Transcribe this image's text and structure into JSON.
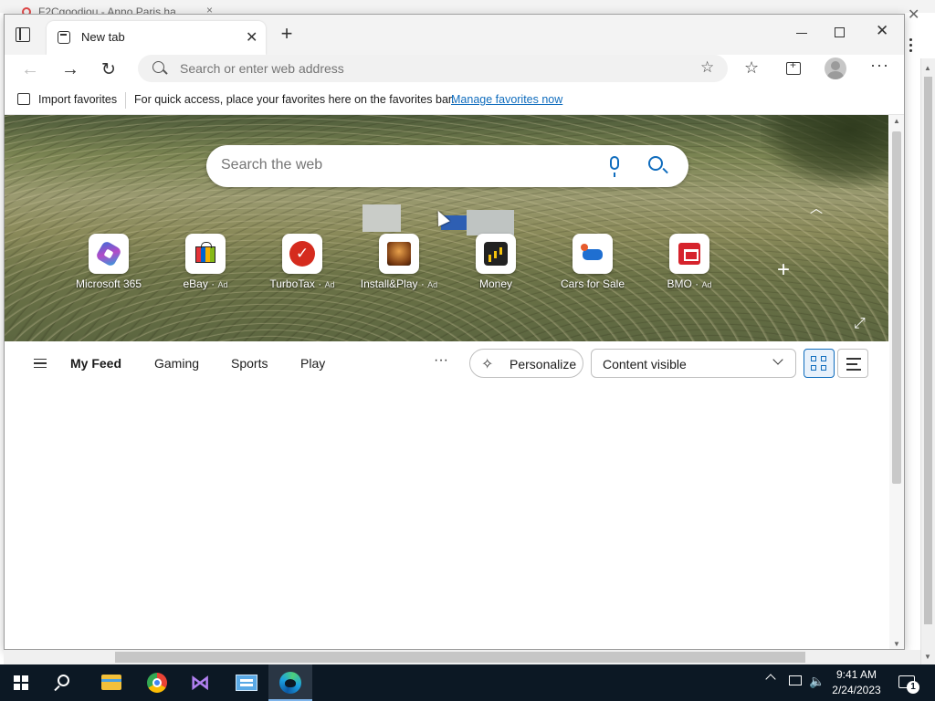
{
  "background_window": {
    "tab_title": "F2Cgoodiou - Anno Paris ha"
  },
  "browser": {
    "tab_title": "New tab",
    "address_placeholder": "Search or enter web address",
    "favorites_bar": {
      "import_label": "Import favorites",
      "message": "For quick access, place your favorites here on the favorites bar.",
      "manage_link": "Manage favorites now"
    }
  },
  "new_tab": {
    "search_placeholder": "Search the web",
    "tiles": [
      {
        "label": "Microsoft 365",
        "ad": ""
      },
      {
        "label": "eBay",
        "ad": "Ad"
      },
      {
        "label": "TurboTax",
        "ad": "Ad"
      },
      {
        "label": "Install&Play",
        "ad": "Ad"
      },
      {
        "label": "Money",
        "ad": ""
      },
      {
        "label": "Cars for Sale",
        "ad": ""
      },
      {
        "label": "BMO",
        "ad": "Ad"
      }
    ],
    "feed_tabs": [
      "My Feed",
      "Gaming",
      "Sports",
      "Play"
    ],
    "more_label": "···",
    "personalize_label": "Personalize",
    "content_select_value": "Content visible"
  },
  "taskbar": {
    "time": "9:41 AM",
    "date": "2/24/2023",
    "notification_count": "1",
    "accent_color": "#7eb4ea"
  },
  "colors": {
    "link": "#0f6cbd",
    "taskbar": "#0c1824"
  }
}
